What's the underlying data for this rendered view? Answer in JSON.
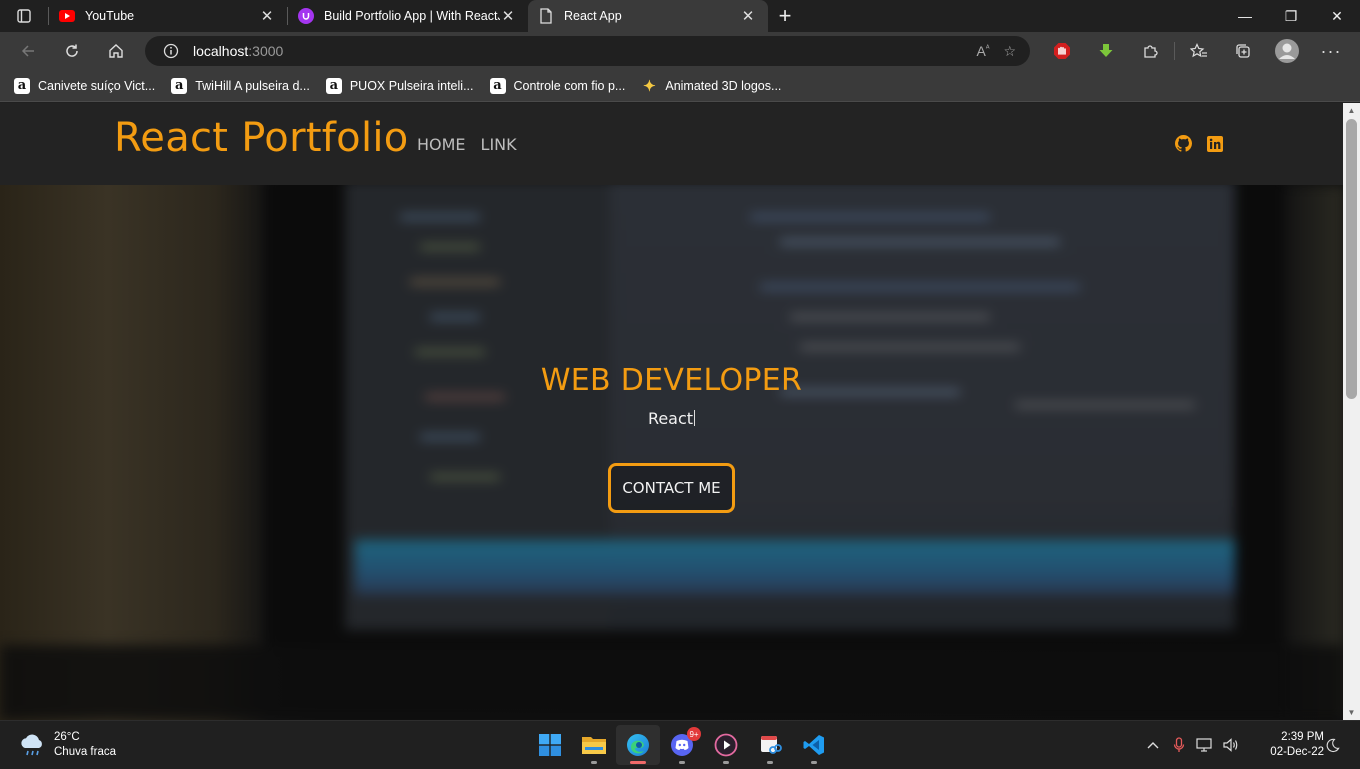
{
  "browser": {
    "tabs": [
      {
        "title": "YouTube",
        "favicon": "youtube-icon",
        "active": false
      },
      {
        "title": "Build Portfolio App | With ReactJS",
        "favicon": "udemy-icon",
        "active": false
      },
      {
        "title": "React App",
        "favicon": "page-icon",
        "active": true
      }
    ],
    "address": {
      "host": "localhost",
      "port": ":3000"
    },
    "bookmarks": [
      {
        "label": "Canivete suíço Vict...",
        "icon": "amazon-icon"
      },
      {
        "label": "TwiHill A pulseira d...",
        "icon": "amazon-icon"
      },
      {
        "label": "PUOX Pulseira inteli...",
        "icon": "amazon-icon"
      },
      {
        "label": "Controle com fio p...",
        "icon": "amazon-icon"
      },
      {
        "label": "Animated 3D logos...",
        "icon": "sparkle-icon"
      }
    ],
    "bookmark_icon_letter": "a",
    "window_controls": {
      "minimize": "—",
      "restore": "❐",
      "close": "✕"
    }
  },
  "site": {
    "brand": "React Portfolio",
    "nav": [
      {
        "label": "HOME"
      },
      {
        "label": "LINK"
      }
    ],
    "social": [
      "github-icon",
      "linkedin-icon"
    ],
    "hero": {
      "title": "WEB DEVELOPER",
      "typed": "React",
      "cta": "CONTACT ME"
    },
    "accent_color": "#f39c12"
  },
  "taskbar": {
    "weather": {
      "temp": "26°C",
      "desc": "Chuva fraca"
    },
    "apps": [
      "windows-start-icon",
      "file-explorer-icon",
      "edge-icon",
      "discord-icon",
      "media-player-icon",
      "snipping-tool-icon",
      "vscode-icon"
    ],
    "discord_badge": "9+",
    "clock": {
      "time": "2:39 PM",
      "date": "02-Dec-22"
    }
  }
}
